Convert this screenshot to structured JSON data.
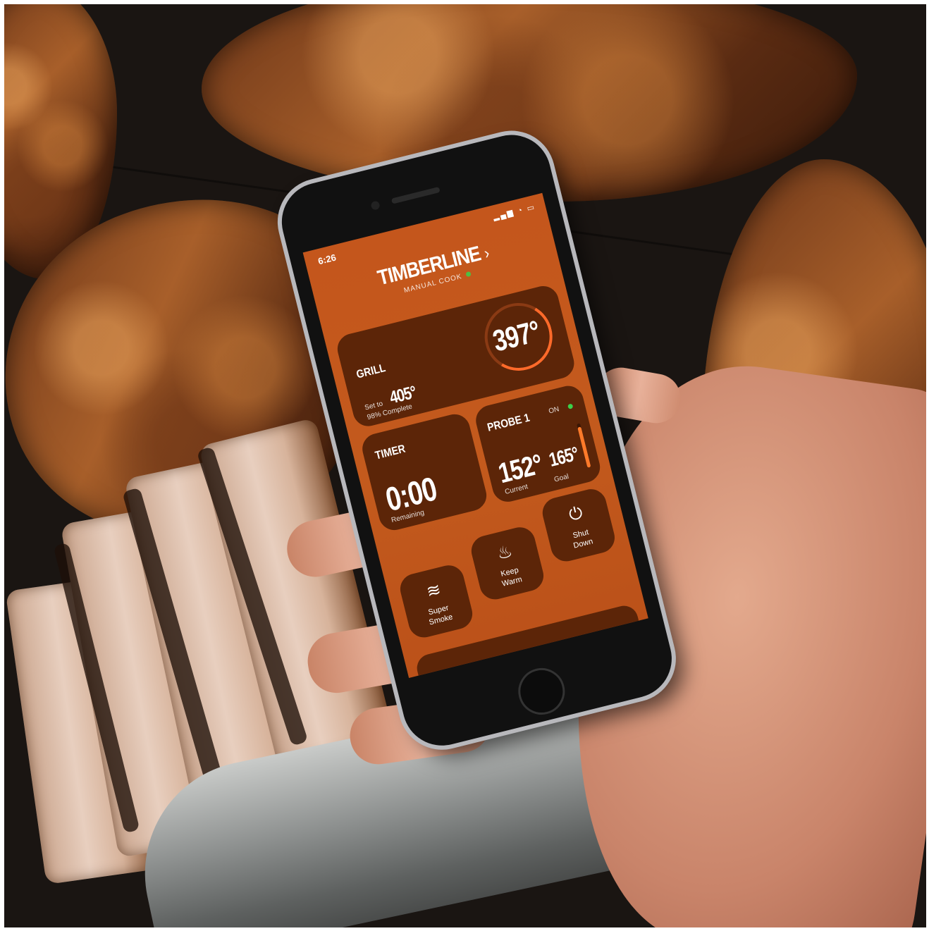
{
  "scene": {
    "description_color_background": "#1a1512",
    "accent": "#c4561c"
  },
  "app": {
    "status_time": "6:26",
    "brand": "TIMBERLINE",
    "mode": "MANUAL COOK",
    "status_dot_color": "#3bd14a",
    "grill": {
      "label": "GRILL",
      "current": "397°",
      "set_label": "Set to",
      "set_value": "405°",
      "progress_text": "98% Complete"
    },
    "timer": {
      "label": "TIMER",
      "value": "0:00",
      "sub": "Remaining"
    },
    "probe": {
      "label": "PROBE 1",
      "state": "ON",
      "current": "152°",
      "current_label": "Current",
      "goal": "165°",
      "goal_label": "Goal",
      "progress_fraction": 0.92
    },
    "buttons": [
      {
        "label_line1": "Super",
        "label_line2": "Smoke",
        "icon": "smoke-icon"
      },
      {
        "label_line1": "Keep",
        "label_line2": "Warm",
        "icon": "heat-waves-icon"
      },
      {
        "label_line1": "Shut",
        "label_line2": "Down",
        "icon": "power-icon"
      }
    ]
  }
}
